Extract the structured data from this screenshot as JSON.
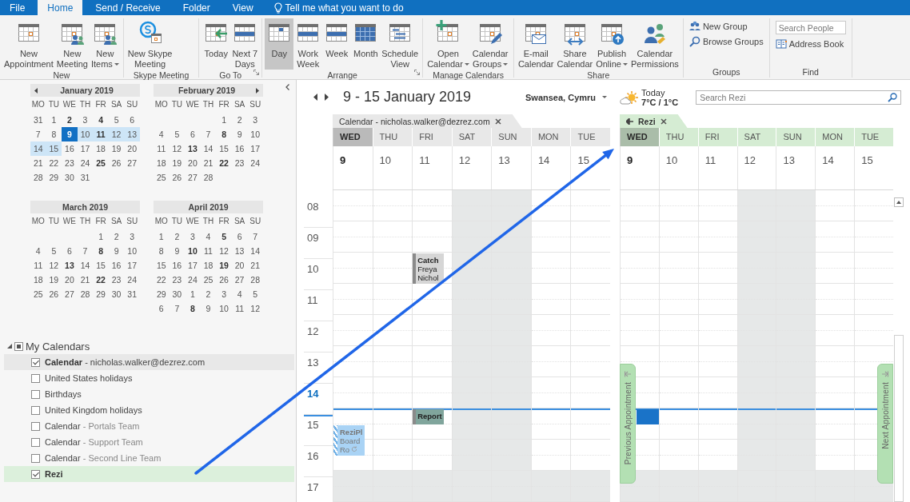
{
  "tabs": [
    {
      "label": "File",
      "selected": false
    },
    {
      "label": "Home",
      "selected": true
    },
    {
      "label": "Send / Receive",
      "selected": false
    },
    {
      "label": "Folder",
      "selected": false
    },
    {
      "label": "View",
      "selected": false
    }
  ],
  "tell_me": "Tell me what you want to do",
  "ribbon": [
    {
      "label": "New",
      "launcher": false,
      "items": [
        {
          "kind": "large",
          "lines": [
            "New",
            "Appointment"
          ],
          "dropdown": false,
          "selected": false
        },
        {
          "kind": "large",
          "lines": [
            "New",
            "Meeting"
          ],
          "dropdown": false,
          "selected": false
        },
        {
          "kind": "large",
          "lines": [
            "New",
            "Items"
          ],
          "dropdown": true,
          "selected": false
        }
      ]
    },
    {
      "label": "Skype Meeting",
      "launcher": false,
      "items": [
        {
          "kind": "large",
          "lines": [
            "New Skype",
            "Meeting"
          ],
          "dropdown": false,
          "selected": false
        }
      ]
    },
    {
      "label": "Go To",
      "launcher": true,
      "items": [
        {
          "kind": "large",
          "lines": [
            "Today"
          ],
          "dropdown": false,
          "selected": false
        },
        {
          "kind": "large",
          "lines": [
            "Next 7",
            "Days"
          ],
          "dropdown": false,
          "selected": false
        }
      ]
    },
    {
      "label": "Arrange",
      "launcher": true,
      "items": [
        {
          "kind": "large",
          "lines": [
            "Day"
          ],
          "dropdown": false,
          "selected": true
        },
        {
          "kind": "large",
          "lines": [
            "Work",
            "Week"
          ],
          "dropdown": false,
          "selected": false
        },
        {
          "kind": "large",
          "lines": [
            "Week"
          ],
          "dropdown": false,
          "selected": false
        },
        {
          "kind": "large",
          "lines": [
            "Month"
          ],
          "dropdown": false,
          "selected": false
        },
        {
          "kind": "large",
          "lines": [
            "Schedule",
            "View"
          ],
          "dropdown": false,
          "selected": false
        }
      ]
    },
    {
      "label": "Manage Calendars",
      "launcher": false,
      "items": [
        {
          "kind": "large",
          "lines": [
            "Open",
            "Calendar"
          ],
          "dropdown": true,
          "selected": false
        },
        {
          "kind": "large",
          "lines": [
            "Calendar",
            "Groups"
          ],
          "dropdown": true,
          "selected": false
        }
      ]
    },
    {
      "label": "Share",
      "launcher": false,
      "items": [
        {
          "kind": "large",
          "lines": [
            "E-mail",
            "Calendar"
          ],
          "dropdown": false,
          "selected": false
        },
        {
          "kind": "large",
          "lines": [
            "Share",
            "Calendar"
          ],
          "dropdown": false,
          "selected": false
        },
        {
          "kind": "large",
          "lines": [
            "Publish",
            "Online"
          ],
          "dropdown": true,
          "selected": false
        },
        {
          "kind": "large",
          "lines": [
            "Calendar",
            "Permissions"
          ],
          "dropdown": false,
          "selected": false
        }
      ]
    },
    {
      "label": "Groups",
      "launcher": false,
      "items": [
        {
          "kind": "small",
          "label": "New Group"
        },
        {
          "kind": "small",
          "label": "Browse Groups"
        }
      ]
    },
    {
      "label": "Find",
      "launcher": false,
      "items": [
        {
          "kind": "search",
          "placeholder": "Search People"
        },
        {
          "kind": "small",
          "label": "Address Book"
        }
      ]
    }
  ],
  "months": [
    {
      "title": "January 2019",
      "prev_arrow": true,
      "next_arrow": false,
      "weekdays": [
        "MO",
        "TU",
        "WE",
        "TH",
        "FR",
        "SA",
        "SU"
      ],
      "weeks": [
        [
          {
            "day": "31",
            "bold": false,
            "selected": false,
            "in_range": false
          },
          {
            "day": "1",
            "bold": false,
            "selected": false,
            "in_range": false
          },
          {
            "day": "2",
            "bold": true,
            "selected": false,
            "in_range": false
          },
          {
            "day": "3",
            "bold": false,
            "selected": false,
            "in_range": false
          },
          {
            "day": "4",
            "bold": true,
            "selected": false,
            "in_range": false
          },
          {
            "day": "5",
            "bold": false,
            "selected": false,
            "in_range": false
          },
          {
            "day": "6",
            "bold": false,
            "selected": false,
            "in_range": false
          }
        ],
        [
          {
            "day": "7",
            "bold": false,
            "selected": false,
            "in_range": false
          },
          {
            "day": "8",
            "bold": false,
            "selected": false,
            "in_range": false
          },
          {
            "day": "9",
            "bold": true,
            "selected": true,
            "in_range": true
          },
          {
            "day": "10",
            "bold": false,
            "selected": false,
            "in_range": true
          },
          {
            "day": "11",
            "bold": true,
            "selected": false,
            "in_range": true
          },
          {
            "day": "12",
            "bold": false,
            "selected": false,
            "in_range": true
          },
          {
            "day": "13",
            "bold": false,
            "selected": false,
            "in_range": true
          }
        ],
        [
          {
            "day": "14",
            "bold": false,
            "selected": false,
            "in_range": true
          },
          {
            "day": "15",
            "bold": false,
            "selected": false,
            "in_range": true
          },
          {
            "day": "16",
            "bold": false,
            "selected": false,
            "in_range": false
          },
          {
            "day": "17",
            "bold": false,
            "selected": false,
            "in_range": false
          },
          {
            "day": "18",
            "bold": false,
            "selected": false,
            "in_range": false
          },
          {
            "day": "19",
            "bold": false,
            "selected": false,
            "in_range": false
          },
          {
            "day": "20",
            "bold": false,
            "selected": false,
            "in_range": false
          }
        ],
        [
          {
            "day": "21",
            "bold": false,
            "selected": false,
            "in_range": false
          },
          {
            "day": "22",
            "bold": false,
            "selected": false,
            "in_range": false
          },
          {
            "day": "23",
            "bold": false,
            "selected": false,
            "in_range": false
          },
          {
            "day": "24",
            "bold": false,
            "selected": false,
            "in_range": false
          },
          {
            "day": "25",
            "bold": true,
            "selected": false,
            "in_range": false
          },
          {
            "day": "26",
            "bold": false,
            "selected": false,
            "in_range": false
          },
          {
            "day": "27",
            "bold": false,
            "selected": false,
            "in_range": false
          }
        ],
        [
          {
            "day": "28",
            "bold": false,
            "selected": false,
            "in_range": false
          },
          {
            "day": "29",
            "bold": false,
            "selected": false,
            "in_range": false
          },
          {
            "day": "30",
            "bold": false,
            "selected": false,
            "in_range": false
          },
          {
            "day": "31",
            "bold": false,
            "selected": false,
            "in_range": false
          }
        ]
      ]
    },
    {
      "title": "February 2019",
      "prev_arrow": false,
      "next_arrow": true,
      "weekdays": [
        "MO",
        "TU",
        "WE",
        "TH",
        "FR",
        "SA",
        "SU"
      ],
      "weeks": [
        [
          {
            "day": "1",
            "bold": false,
            "selected": false,
            "in_range": false
          },
          {
            "day": "2",
            "bold": false,
            "selected": false,
            "in_range": false
          },
          {
            "day": "3",
            "bold": false,
            "selected": false,
            "in_range": false
          }
        ],
        [
          {
            "day": "4",
            "bold": false,
            "selected": false,
            "in_range": false
          },
          {
            "day": "5",
            "bold": false,
            "selected": false,
            "in_range": false
          },
          {
            "day": "6",
            "bold": false,
            "selected": false,
            "in_range": false
          },
          {
            "day": "7",
            "bold": false,
            "selected": false,
            "in_range": false
          },
          {
            "day": "8",
            "bold": true,
            "selected": false,
            "in_range": false
          },
          {
            "day": "9",
            "bold": false,
            "selected": false,
            "in_range": false
          },
          {
            "day": "10",
            "bold": false,
            "selected": false,
            "in_range": false
          }
        ],
        [
          {
            "day": "11",
            "bold": false,
            "selected": false,
            "in_range": false
          },
          {
            "day": "12",
            "bold": false,
            "selected": false,
            "in_range": false
          },
          {
            "day": "13",
            "bold": true,
            "selected": false,
            "in_range": false
          },
          {
            "day": "14",
            "bold": false,
            "selected": false,
            "in_range": false
          },
          {
            "day": "15",
            "bold": false,
            "selected": false,
            "in_range": false
          },
          {
            "day": "16",
            "bold": false,
            "selected": false,
            "in_range": false
          },
          {
            "day": "17",
            "bold": false,
            "selected": false,
            "in_range": false
          }
        ],
        [
          {
            "day": "18",
            "bold": false,
            "selected": false,
            "in_range": false
          },
          {
            "day": "19",
            "bold": false,
            "selected": false,
            "in_range": false
          },
          {
            "day": "20",
            "bold": false,
            "selected": false,
            "in_range": false
          },
          {
            "day": "21",
            "bold": false,
            "selected": false,
            "in_range": false
          },
          {
            "day": "22",
            "bold": true,
            "selected": false,
            "in_range": false
          },
          {
            "day": "23",
            "bold": false,
            "selected": false,
            "in_range": false
          },
          {
            "day": "24",
            "bold": false,
            "selected": false,
            "in_range": false
          }
        ],
        [
          {
            "day": "25",
            "bold": false,
            "selected": false,
            "in_range": false
          },
          {
            "day": "26",
            "bold": false,
            "selected": false,
            "in_range": false
          },
          {
            "day": "27",
            "bold": false,
            "selected": false,
            "in_range": false
          },
          {
            "day": "28",
            "bold": false,
            "selected": false,
            "in_range": false
          }
        ]
      ]
    },
    {
      "title": "March 2019",
      "prev_arrow": false,
      "next_arrow": false,
      "weekdays": [
        "MO",
        "TU",
        "WE",
        "TH",
        "FR",
        "SA",
        "SU"
      ],
      "weeks": [
        [
          {
            "day": "1",
            "bold": false,
            "selected": false,
            "in_range": false
          },
          {
            "day": "2",
            "bold": false,
            "selected": false,
            "in_range": false
          },
          {
            "day": "3",
            "bold": false,
            "selected": false,
            "in_range": false
          }
        ],
        [
          {
            "day": "4",
            "bold": false,
            "selected": false,
            "in_range": false
          },
          {
            "day": "5",
            "bold": false,
            "selected": false,
            "in_range": false
          },
          {
            "day": "6",
            "bold": false,
            "selected": false,
            "in_range": false
          },
          {
            "day": "7",
            "bold": false,
            "selected": false,
            "in_range": false
          },
          {
            "day": "8",
            "bold": true,
            "selected": false,
            "in_range": false
          },
          {
            "day": "9",
            "bold": false,
            "selected": false,
            "in_range": false
          },
          {
            "day": "10",
            "bold": false,
            "selected": false,
            "in_range": false
          }
        ],
        [
          {
            "day": "11",
            "bold": false,
            "selected": false,
            "in_range": false
          },
          {
            "day": "12",
            "bold": false,
            "selected": false,
            "in_range": false
          },
          {
            "day": "13",
            "bold": true,
            "selected": false,
            "in_range": false
          },
          {
            "day": "14",
            "bold": false,
            "selected": false,
            "in_range": false
          },
          {
            "day": "15",
            "bold": false,
            "selected": false,
            "in_range": false
          },
          {
            "day": "16",
            "bold": false,
            "selected": false,
            "in_range": false
          },
          {
            "day": "17",
            "bold": false,
            "selected": false,
            "in_range": false
          }
        ],
        [
          {
            "day": "18",
            "bold": false,
            "selected": false,
            "in_range": false
          },
          {
            "day": "19",
            "bold": false,
            "selected": false,
            "in_range": false
          },
          {
            "day": "20",
            "bold": false,
            "selected": false,
            "in_range": false
          },
          {
            "day": "21",
            "bold": false,
            "selected": false,
            "in_range": false
          },
          {
            "day": "22",
            "bold": true,
            "selected": false,
            "in_range": false
          },
          {
            "day": "23",
            "bold": false,
            "selected": false,
            "in_range": false
          },
          {
            "day": "24",
            "bold": false,
            "selected": false,
            "in_range": false
          }
        ],
        [
          {
            "day": "25",
            "bold": false,
            "selected": false,
            "in_range": false
          },
          {
            "day": "26",
            "bold": false,
            "selected": false,
            "in_range": false
          },
          {
            "day": "27",
            "bold": false,
            "selected": false,
            "in_range": false
          },
          {
            "day": "28",
            "bold": false,
            "selected": false,
            "in_range": false
          },
          {
            "day": "29",
            "bold": false,
            "selected": false,
            "in_range": false
          },
          {
            "day": "30",
            "bold": false,
            "selected": false,
            "in_range": false
          },
          {
            "day": "31",
            "bold": false,
            "selected": false,
            "in_range": false
          }
        ]
      ]
    },
    {
      "title": "April 2019",
      "prev_arrow": false,
      "next_arrow": false,
      "weekdays": [
        "MO",
        "TU",
        "WE",
        "TH",
        "FR",
        "SA",
        "SU"
      ],
      "weeks": [
        [
          {
            "day": "1",
            "bold": false,
            "selected": false,
            "in_range": false
          },
          {
            "day": "2",
            "bold": false,
            "selected": false,
            "in_range": false
          },
          {
            "day": "3",
            "bold": false,
            "selected": false,
            "in_range": false
          },
          {
            "day": "4",
            "bold": false,
            "selected": false,
            "in_range": false
          },
          {
            "day": "5",
            "bold": true,
            "selected": false,
            "in_range": false
          },
          {
            "day": "6",
            "bold": false,
            "selected": false,
            "in_range": false
          },
          {
            "day": "7",
            "bold": false,
            "selected": false,
            "in_range": false
          }
        ],
        [
          {
            "day": "8",
            "bold": false,
            "selected": false,
            "in_range": false
          },
          {
            "day": "9",
            "bold": false,
            "selected": false,
            "in_range": false
          },
          {
            "day": "10",
            "bold": true,
            "selected": false,
            "in_range": false
          },
          {
            "day": "11",
            "bold": false,
            "selected": false,
            "in_range": false
          },
          {
            "day": "12",
            "bold": false,
            "selected": false,
            "in_range": false
          },
          {
            "day": "13",
            "bold": false,
            "selected": false,
            "in_range": false
          },
          {
            "day": "14",
            "bold": false,
            "selected": false,
            "in_range": false
          }
        ],
        [
          {
            "day": "15",
            "bold": false,
            "selected": false,
            "in_range": false
          },
          {
            "day": "16",
            "bold": false,
            "selected": false,
            "in_range": false
          },
          {
            "day": "17",
            "bold": false,
            "selected": false,
            "in_range": false
          },
          {
            "day": "18",
            "bold": false,
            "selected": false,
            "in_range": false
          },
          {
            "day": "19",
            "bold": true,
            "selected": false,
            "in_range": false
          },
          {
            "day": "20",
            "bold": false,
            "selected": false,
            "in_range": false
          },
          {
            "day": "21",
            "bold": false,
            "selected": false,
            "in_range": false
          }
        ],
        [
          {
            "day": "22",
            "bold": false,
            "selected": false,
            "in_range": false
          },
          {
            "day": "23",
            "bold": false,
            "selected": false,
            "in_range": false
          },
          {
            "day": "24",
            "bold": false,
            "selected": false,
            "in_range": false
          },
          {
            "day": "25",
            "bold": false,
            "selected": false,
            "in_range": false
          },
          {
            "day": "26",
            "bold": false,
            "selected": false,
            "in_range": false
          },
          {
            "day": "27",
            "bold": false,
            "selected": false,
            "in_range": false
          },
          {
            "day": "28",
            "bold": false,
            "selected": false,
            "in_range": false
          }
        ],
        [
          {
            "day": "29",
            "bold": false,
            "selected": false,
            "in_range": false
          },
          {
            "day": "30",
            "bold": false,
            "selected": false,
            "in_range": false
          },
          {
            "day": "1",
            "bold": false,
            "selected": false,
            "in_range": false
          },
          {
            "day": "2",
            "bold": false,
            "selected": false,
            "in_range": false
          },
          {
            "day": "3",
            "bold": false,
            "selected": false,
            "in_range": false
          },
          {
            "day": "4",
            "bold": false,
            "selected": false,
            "in_range": false
          },
          {
            "day": "5",
            "bold": false,
            "selected": false,
            "in_range": false
          }
        ],
        [
          {
            "day": "6",
            "bold": false,
            "selected": false,
            "in_range": false
          },
          {
            "day": "7",
            "bold": false,
            "selected": false,
            "in_range": false
          },
          {
            "day": "8",
            "bold": true,
            "selected": false,
            "in_range": false
          },
          {
            "day": "9",
            "bold": false,
            "selected": false,
            "in_range": false
          },
          {
            "day": "10",
            "bold": false,
            "selected": false,
            "in_range": false
          },
          {
            "day": "11",
            "bold": false,
            "selected": false,
            "in_range": false
          },
          {
            "day": "12",
            "bold": false,
            "selected": false,
            "in_range": false
          }
        ]
      ]
    }
  ],
  "calendar_group": {
    "label": "My Calendars",
    "expanded": true,
    "checked": true,
    "items": [
      {
        "name": "Calendar",
        "detail": "- nicholas.walker@dezrez.com",
        "checked": true,
        "selected": true
      },
      {
        "name": "United States holidays",
        "checked": false,
        "selected": false
      },
      {
        "name": "Birthdays",
        "checked": false,
        "selected": false
      },
      {
        "name": "United Kingdom holidays",
        "checked": false,
        "selected": false
      },
      {
        "name": "Calendar",
        "detail": "- Portals Team",
        "checked": false,
        "selected": false
      },
      {
        "name": "Calendar",
        "detail": "- Support Team",
        "checked": false,
        "selected": false
      },
      {
        "name": "Calendar",
        "detail": "- Second Line Team",
        "checked": false,
        "selected": false
      },
      {
        "name": "Rezi",
        "checked": true,
        "selected": false,
        "color": "#dcf0dc"
      }
    ]
  },
  "header": {
    "date_range": "9 - 15 January 2019",
    "location": "Swansea, Cymru",
    "weather": {
      "label": "Today",
      "temps": "7°C / 1°C"
    },
    "search": {
      "placeholder": "Search Rezi"
    }
  },
  "hours": [
    {
      "label": "08",
      "current": false,
      "now": false
    },
    {
      "label": "09",
      "current": false,
      "now": false
    },
    {
      "label": "10",
      "current": false,
      "now": false
    },
    {
      "label": "11",
      "current": false,
      "now": false
    },
    {
      "label": "12",
      "current": false,
      "now": false
    },
    {
      "label": "13",
      "current": false,
      "now": false
    },
    {
      "label": "14",
      "current": true,
      "now": false
    },
    {
      "label": "15",
      "current": false,
      "now": true
    },
    {
      "label": "16",
      "current": false,
      "now": false
    },
    {
      "label": "17",
      "current": false,
      "now": false
    }
  ],
  "panes": [
    {
      "tab": {
        "label": "Calendar - nicholas.walker@dezrez.com",
        "back_arrow": false
      },
      "color": "#e8e8e8",
      "days": [
        {
          "dow": "WED",
          "date": "9",
          "today": true,
          "slots": [
            {
              "shaded": false
            },
            {
              "shaded": false
            },
            {
              "shaded": false
            },
            {
              "shaded": false
            },
            {
              "shaded": false
            },
            {
              "shaded": false
            },
            {
              "shaded": false
            },
            {
              "shaded": false,
              "events": [
                {
                  "kind": "tentative",
                  "half_past": true,
                  "half_hour": false,
                  "color": "#a9d3f5",
                  "recurring": true,
                  "lines": [
                    "ReziPl",
                    "Board",
                    "Ro"
                  ]
                }
              ]
            },
            {
              "shaded": false
            },
            {
              "shaded": true
            }
          ]
        },
        {
          "dow": "THU",
          "date": "10",
          "today": false,
          "slots": [
            {
              "shaded": false
            },
            {
              "shaded": false
            },
            {
              "shaded": false
            },
            {
              "shaded": false
            },
            {
              "shaded": false
            },
            {
              "shaded": false
            },
            {
              "shaded": false
            },
            {
              "shaded": false
            },
            {
              "shaded": false
            },
            {
              "shaded": true
            }
          ]
        },
        {
          "dow": "FRI",
          "date": "11",
          "today": false,
          "slots": [
            {
              "shaded": false
            },
            {
              "shaded": false
            },
            {
              "shaded": false,
              "events": [
                {
                  "kind": "busy",
                  "half_past": false,
                  "half_hour": false,
                  "color": "#d6d6d6",
                  "recurring": false,
                  "lines": [
                    "Catch",
                    "Freya",
                    "Nichol"
                  ]
                }
              ]
            },
            {
              "shaded": false
            },
            {
              "shaded": false
            },
            {
              "shaded": false
            },
            {
              "shaded": false
            },
            {
              "shaded": false,
              "events": [
                {
                  "kind": "busy",
                  "half_past": false,
                  "half_hour": true,
                  "color": "#80a59c",
                  "lines": [
                    "Report"
                  ]
                }
              ]
            },
            {
              "shaded": false
            },
            {
              "shaded": true
            }
          ]
        },
        {
          "dow": "SAT",
          "date": "12",
          "today": false,
          "slots": [
            {
              "shaded": true
            },
            {
              "shaded": true
            },
            {
              "shaded": true
            },
            {
              "shaded": true
            },
            {
              "shaded": true
            },
            {
              "shaded": true
            },
            {
              "shaded": true
            },
            {
              "shaded": true
            },
            {
              "shaded": true
            },
            {
              "shaded": true
            }
          ]
        },
        {
          "dow": "SUN",
          "date": "13",
          "today": false,
          "slots": [
            {
              "shaded": true
            },
            {
              "shaded": true
            },
            {
              "shaded": true
            },
            {
              "shaded": true
            },
            {
              "shaded": true
            },
            {
              "shaded": true
            },
            {
              "shaded": true
            },
            {
              "shaded": true
            },
            {
              "shaded": true
            },
            {
              "shaded": true
            }
          ]
        },
        {
          "dow": "MON",
          "date": "14",
          "today": false,
          "slots": [
            {
              "shaded": false
            },
            {
              "shaded": false
            },
            {
              "shaded": false
            },
            {
              "shaded": false
            },
            {
              "shaded": false
            },
            {
              "shaded": false
            },
            {
              "shaded": false
            },
            {
              "shaded": false
            },
            {
              "shaded": false
            },
            {
              "shaded": true
            }
          ]
        },
        {
          "dow": "TUE",
          "date": "15",
          "today": false,
          "slots": [
            {
              "shaded": false
            },
            {
              "shaded": false
            },
            {
              "shaded": false
            },
            {
              "shaded": false
            },
            {
              "shaded": false
            },
            {
              "shaded": false
            },
            {
              "shaded": false
            },
            {
              "shaded": false
            },
            {
              "shaded": false
            },
            {
              "shaded": true
            }
          ]
        }
      ]
    },
    {
      "tab": {
        "label": "Rezi",
        "back_arrow": true
      },
      "color": "#d5ecd3",
      "days": [
        {
          "dow": "WED",
          "date": "9",
          "today": true,
          "slots": [
            {
              "shaded": false
            },
            {
              "shaded": false
            },
            {
              "shaded": false
            },
            {
              "shaded": false
            },
            {
              "shaded": false
            },
            {
              "shaded": false
            },
            {
              "shaded": false
            },
            {
              "shaded": false,
              "events": [
                {
                  "kind": "selection",
                  "half_past": false,
                  "half_hour": true,
                  "color": "#1a73c8"
                }
              ]
            },
            {
              "shaded": false
            },
            {
              "shaded": true
            }
          ]
        },
        {
          "dow": "THU",
          "date": "10",
          "today": false,
          "slots": [
            {
              "shaded": false
            },
            {
              "shaded": false
            },
            {
              "shaded": false
            },
            {
              "shaded": false
            },
            {
              "shaded": false
            },
            {
              "shaded": false
            },
            {
              "shaded": false
            },
            {
              "shaded": false
            },
            {
              "shaded": false
            },
            {
              "shaded": true
            }
          ]
        },
        {
          "dow": "FRI",
          "date": "11",
          "today": false,
          "slots": [
            {
              "shaded": false
            },
            {
              "shaded": false
            },
            {
              "shaded": false
            },
            {
              "shaded": false
            },
            {
              "shaded": false
            },
            {
              "shaded": false
            },
            {
              "shaded": false
            },
            {
              "shaded": false
            },
            {
              "shaded": false
            },
            {
              "shaded": true
            }
          ]
        },
        {
          "dow": "SAT",
          "date": "12",
          "today": false,
          "slots": [
            {
              "shaded": true
            },
            {
              "shaded": true
            },
            {
              "shaded": true
            },
            {
              "shaded": true
            },
            {
              "shaded": true
            },
            {
              "shaded": true
            },
            {
              "shaded": true
            },
            {
              "shaded": true
            },
            {
              "shaded": true
            },
            {
              "shaded": true
            }
          ]
        },
        {
          "dow": "SUN",
          "date": "13",
          "today": false,
          "slots": [
            {
              "shaded": true
            },
            {
              "shaded": true
            },
            {
              "shaded": true
            },
            {
              "shaded": true
            },
            {
              "shaded": true
            },
            {
              "shaded": true
            },
            {
              "shaded": true
            },
            {
              "shaded": true
            },
            {
              "shaded": true
            },
            {
              "shaded": true
            }
          ]
        },
        {
          "dow": "MON",
          "date": "14",
          "today": false,
          "slots": [
            {
              "shaded": false
            },
            {
              "shaded": false
            },
            {
              "shaded": false
            },
            {
              "shaded": false
            },
            {
              "shaded": false
            },
            {
              "shaded": false
            },
            {
              "shaded": false
            },
            {
              "shaded": false
            },
            {
              "shaded": false
            },
            {
              "shaded": true
            }
          ]
        },
        {
          "dow": "TUE",
          "date": "15",
          "today": false,
          "slots": [
            {
              "shaded": false
            },
            {
              "shaded": false
            },
            {
              "shaded": false
            },
            {
              "shaded": false
            },
            {
              "shaded": false
            },
            {
              "shaded": false
            },
            {
              "shaded": false
            },
            {
              "shaded": false
            },
            {
              "shaded": false
            },
            {
              "shaded": true
            }
          ]
        }
      ],
      "side_buttons": [
        {
          "kind": "previous",
          "label": "Previous Appointment"
        },
        {
          "kind": "next",
          "label": "Next Appointment"
        }
      ]
    }
  ]
}
